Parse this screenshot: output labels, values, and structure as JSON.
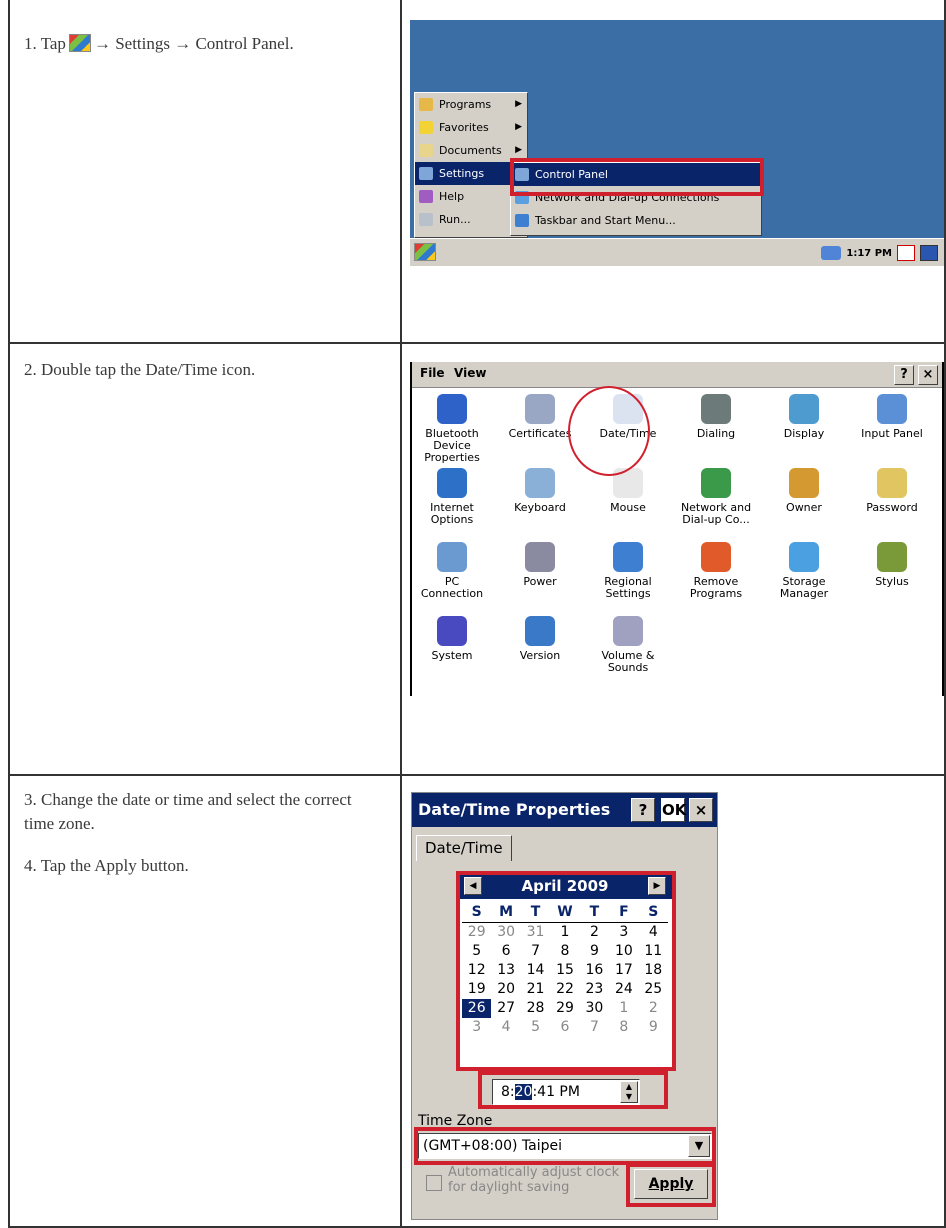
{
  "steps": [
    {
      "text_before": "1.  Tap",
      "text_after": "→ Settings → Control Panel."
    },
    {
      "text": "2.  Double tap the Date/Time icon."
    },
    {
      "text": "3.  Change the date or time and select the correct time zone."
    },
    {
      "text": "4.  Tap the Apply button."
    }
  ],
  "start_menu": {
    "items": [
      "Programs",
      "Favorites",
      "Documents",
      "Settings",
      "Help",
      "Run..."
    ],
    "submenu": [
      "Control Panel",
      "Network and Dial-up Connections",
      "Taskbar and Start Menu..."
    ],
    "clock": "1:17 PM"
  },
  "control_panel": {
    "menu": [
      "File",
      "View"
    ],
    "buttons": [
      "?",
      "×"
    ],
    "items": [
      "Bluetooth Device Properties",
      "Certificates",
      "Date/Time",
      "Dialing",
      "Display",
      "Input Panel",
      "Internet Options",
      "Keyboard",
      "Mouse",
      "Network and Dial-up Co...",
      "Owner",
      "Password",
      "PC Connection",
      "Power",
      "Regional Settings",
      "Remove Programs",
      "Storage Manager",
      "Stylus",
      "System",
      "Version",
      "Volume & Sounds"
    ]
  },
  "datetime": {
    "title": "Date/Time Properties",
    "buttons": [
      "?",
      "OK",
      "×"
    ],
    "tab": "Date/Time",
    "month": "April 2009",
    "dow": [
      "S",
      "M",
      "T",
      "W",
      "T",
      "F",
      "S"
    ],
    "days": [
      "29",
      "30",
      "31",
      "1",
      "2",
      "3",
      "4",
      "5",
      "6",
      "7",
      "8",
      "9",
      "10",
      "11",
      "12",
      "13",
      "14",
      "15",
      "16",
      "17",
      "18",
      "19",
      "20",
      "21",
      "22",
      "23",
      "24",
      "25",
      "26",
      "27",
      "28",
      "29",
      "30",
      "1",
      "2",
      "3",
      "4",
      "5",
      "6",
      "7",
      "8",
      "9"
    ],
    "time_pre": "8:",
    "time_sel": "20",
    "time_post": ":41 PM",
    "tz_label": "Time Zone",
    "tz_value": "(GMT+08:00) Taipei",
    "dst_label": "Automatically adjust clock for daylight saving",
    "apply": "Apply"
  }
}
